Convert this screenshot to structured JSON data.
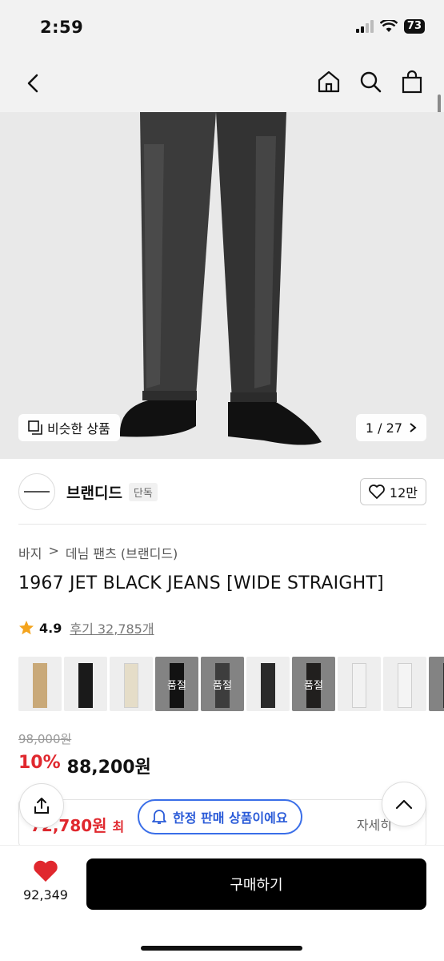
{
  "status": {
    "time": "2:59",
    "battery": "73"
  },
  "nav": {
    "back_icon": "chevron-left-icon",
    "home_icon": "home-icon",
    "search_icon": "search-icon",
    "cart_icon": "bag-icon"
  },
  "gallery": {
    "similar_label": "비슷한 상품",
    "counter": "1 / 27"
  },
  "brand": {
    "name": "브랜디드",
    "tag": "단독",
    "likes": "12만"
  },
  "breadcrumb": [
    "바지",
    "데님 팬츠 (브랜디드)"
  ],
  "product": {
    "title": "1967 JET BLACK JEANS [WIDE STRAIGHT]",
    "rating": "4.9",
    "reviews": "후기 32,785개",
    "original_price": "98,000원",
    "discount": "10%",
    "price": "88,200원"
  },
  "thumbnails": [
    {
      "color": "#c9a979",
      "soldout": ""
    },
    {
      "color": "#1a1a1a",
      "soldout": ""
    },
    {
      "color": "#e5ddc8",
      "soldout": ""
    },
    {
      "color": "#222222",
      "soldout": "품절"
    },
    {
      "color": "#6f6f6f",
      "soldout": "품절"
    },
    {
      "color": "#2a2a2a",
      "soldout": ""
    },
    {
      "color": "#3d3a37",
      "soldout": "품절"
    },
    {
      "color": "#f2f2f2",
      "soldout": ""
    },
    {
      "color": "#f4f4f4",
      "soldout": ""
    },
    {
      "color": "#555555",
      "soldout": "품"
    }
  ],
  "coupon": {
    "price": "72,780원",
    "price_suffix": "최",
    "more": "자세히"
  },
  "limited_pill": "한정 판매 상품이에요",
  "bottom": {
    "wish_count": "92,349",
    "buy_label": "구매하기"
  }
}
